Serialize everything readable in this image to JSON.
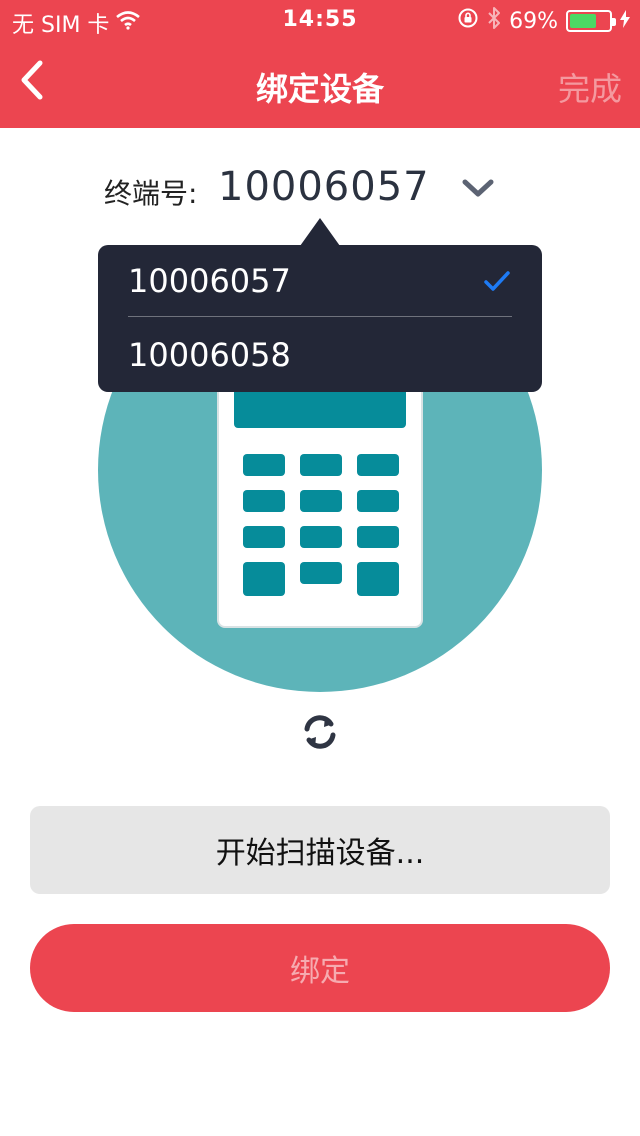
{
  "status_bar": {
    "carrier": "无 SIM 卡",
    "time": "14:55",
    "battery_percent": "69%",
    "battery_level": 0.69,
    "icons": [
      "wifi-icon",
      "orientation-lock-icon",
      "bluetooth-icon",
      "battery-icon",
      "charging-icon"
    ]
  },
  "nav": {
    "title": "绑定设备",
    "done_label": "完成",
    "back_icon": "chevron-left-icon"
  },
  "terminal": {
    "label": "终端号:",
    "value": "10006057",
    "toggle_icon": "chevron-down-icon"
  },
  "dropdown": {
    "options": [
      {
        "label": "10006057",
        "selected": true
      },
      {
        "label": "10006058",
        "selected": false
      }
    ],
    "check_icon": "checkmark-icon"
  },
  "illustration": {
    "icon": "pos-terminal-icon"
  },
  "refresh": {
    "icon": "refresh-icon"
  },
  "buttons": {
    "scan_label": "开始扫描设备...",
    "bind_label": "绑定"
  },
  "colors": {
    "accent": "#EC4550",
    "teal": "#068C9A",
    "circle": "#5DB4B9",
    "popup": "#232737",
    "check": "#1E7BF5"
  }
}
